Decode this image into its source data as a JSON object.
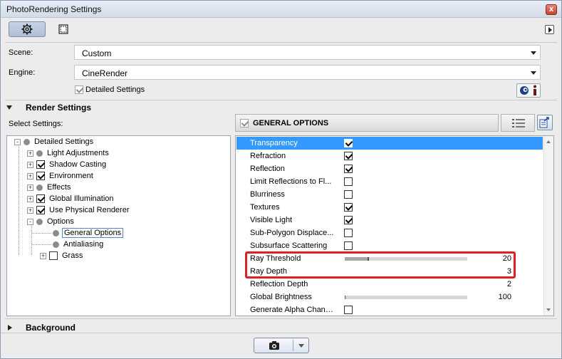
{
  "window": {
    "title": "PhotoRendering Settings",
    "close_label": "x"
  },
  "scene": {
    "label": "Scene:",
    "value": "Custom"
  },
  "engine": {
    "label": "Engine:",
    "value": "CineRender"
  },
  "detailed_settings": {
    "label": "Detailed Settings",
    "checked": true
  },
  "render_settings": {
    "title": "Render Settings",
    "select_label": "Select Settings:"
  },
  "tree": [
    {
      "label": "Detailed Settings",
      "level": 0,
      "expander": "-",
      "marker": "dot"
    },
    {
      "label": "Light Adjustments",
      "level": 1,
      "expander": "+",
      "marker": "dot"
    },
    {
      "label": "Shadow Casting",
      "level": 1,
      "expander": "+",
      "marker": "checked"
    },
    {
      "label": "Environment",
      "level": 1,
      "expander": "+",
      "marker": "checked"
    },
    {
      "label": "Effects",
      "level": 1,
      "expander": "+",
      "marker": "dot"
    },
    {
      "label": "Global Illumination",
      "level": 1,
      "expander": "+",
      "marker": "checked"
    },
    {
      "label": "Use Physical Renderer",
      "level": 1,
      "expander": "+",
      "marker": "checked"
    },
    {
      "label": "Options",
      "level": 1,
      "expander": "-",
      "marker": "dot"
    },
    {
      "label": "General Options",
      "level": 2,
      "expander": "",
      "marker": "dot",
      "selected": true
    },
    {
      "label": "Antialiasing",
      "level": 2,
      "expander": "",
      "marker": "dot"
    },
    {
      "label": "Grass",
      "level": 1,
      "expander": "+",
      "marker": "unchecked"
    }
  ],
  "general_options": {
    "title": "GENERAL OPTIONS",
    "rows": [
      {
        "name": "Transparency",
        "type": "checkbox",
        "checked": true,
        "selected": true
      },
      {
        "name": "Refraction",
        "type": "checkbox",
        "checked": true
      },
      {
        "name": "Reflection",
        "type": "checkbox",
        "checked": true
      },
      {
        "name": "Limit Reflections to Fl...",
        "type": "checkbox",
        "checked": false
      },
      {
        "name": "Blurriness",
        "type": "checkbox",
        "checked": false
      },
      {
        "name": "Textures",
        "type": "checkbox",
        "checked": true
      },
      {
        "name": "Visible Light",
        "type": "checkbox",
        "checked": true
      },
      {
        "name": "Sub-Polygon Displace...",
        "type": "checkbox",
        "checked": false
      },
      {
        "name": "Subsurface Scattering",
        "type": "checkbox",
        "checked": false
      },
      {
        "name": "Ray Threshold",
        "type": "slider",
        "level_percent": 20,
        "value": "20"
      },
      {
        "name": "Ray Depth",
        "type": "number",
        "value": "3"
      },
      {
        "name": "Reflection Depth",
        "type": "number",
        "value": "2"
      },
      {
        "name": "Global Brightness",
        "type": "slider",
        "level_percent": 0,
        "value": "100"
      },
      {
        "name": "Generate Alpha Channel",
        "type": "checkbox",
        "checked": false
      }
    ]
  },
  "background": {
    "title": "Background"
  },
  "icons": {
    "settings_tab": "gear-icon",
    "size_tab": "frame-icon",
    "cinema4d": "cinema4d-icon",
    "info": "info-icon",
    "list_view": "list-icon",
    "export": "export-icon",
    "render": "camera-icon"
  },
  "colors": {
    "selection": "#3399ff",
    "highlight_box": "#e02020"
  }
}
